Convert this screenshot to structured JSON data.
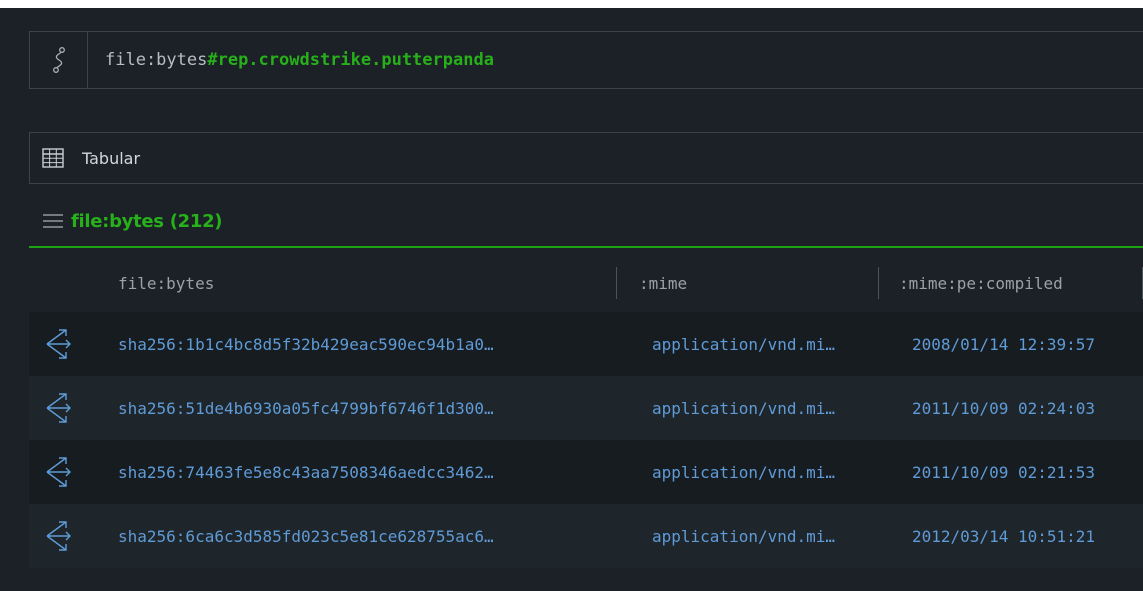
{
  "query": {
    "form": "file:bytes",
    "tag": "#rep.crowdstrike.putterpanda",
    "icon": "storm-query-icon"
  },
  "view": {
    "icon": "table-icon",
    "label": "Tabular"
  },
  "result": {
    "icon": "menu-icon",
    "title": "file:bytes (212)"
  },
  "colors": {
    "accent_green": "#27b01a",
    "link_blue": "#5f9bd6",
    "background": "#1b2127"
  },
  "table": {
    "columns": [
      "file:bytes",
      ":mime",
      ":mime:pe:compiled"
    ],
    "rows": [
      {
        "bytes": "sha256:1b1c4bc8d5f32b429eac590ec94b1a0…",
        "mime": "application/vnd.mi…",
        "compiled": "2008/01/14 12:39:57"
      },
      {
        "bytes": "sha256:51de4b6930a05fc4799bf6746f1d300…",
        "mime": "application/vnd.mi…",
        "compiled": "2011/10/09 02:24:03"
      },
      {
        "bytes": "sha256:74463fe5e8c43aa7508346aedcc3462…",
        "mime": "application/vnd.mi…",
        "compiled": "2011/10/09 02:21:53"
      },
      {
        "bytes": "sha256:6ca6c3d585fd023c5e81ce628755ac6…",
        "mime": "application/vnd.mi…",
        "compiled": "2012/03/14 10:51:21"
      }
    ]
  }
}
